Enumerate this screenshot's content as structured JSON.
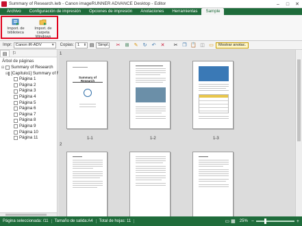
{
  "window": {
    "title": "Summary of Research.iwb - Canon imageRUNNER ADVANCE Desktop - Editor",
    "controls": [
      "–",
      "□",
      "✕"
    ]
  },
  "ribbon_tabs": [
    {
      "label": "Archivo",
      "active": false
    },
    {
      "label": "Configuración de impresión",
      "active": false
    },
    {
      "label": "Opciones de impresión",
      "active": false
    },
    {
      "label": "Anotaciones",
      "active": false
    },
    {
      "label": "Herramientas",
      "active": false
    },
    {
      "label": "Sample",
      "active": true
    }
  ],
  "ribbon": {
    "import_library": "Import. de biblioteca",
    "import_folder": "Import. de carpeta Windows"
  },
  "toolbar": {
    "printer_label": "Impr:",
    "printer_value": "Canon iR-ADV",
    "copies_label": "Copias:",
    "copies_value": "1",
    "duplex_value": "Simpl.",
    "show_annotations": "Mostrar anotac."
  },
  "left_panel": {
    "title": "Árbol de páginas",
    "tree": [
      {
        "label": "Summary of Research",
        "level": 0
      },
      {
        "label": "[Capítulo1] Summary of R",
        "level": 1
      },
      {
        "label": "Página 1",
        "level": 2
      },
      {
        "label": "Página 2",
        "level": 2
      },
      {
        "label": "Página 3",
        "level": 2
      },
      {
        "label": "Página 4",
        "level": 2
      },
      {
        "label": "Página 5",
        "level": 2
      },
      {
        "label": "Página 6",
        "level": 2
      },
      {
        "label": "Página 7",
        "level": 2
      },
      {
        "label": "Página 8",
        "level": 2
      },
      {
        "label": "Página 9",
        "level": 2
      },
      {
        "label": "Página 10",
        "level": 2
      },
      {
        "label": "Página 11",
        "level": 2
      }
    ]
  },
  "thumbnails": {
    "group_labels": [
      "1",
      "2"
    ],
    "row1_captions": [
      "1-1",
      "1-2",
      "1-3"
    ],
    "page1_subtitle": "Summary of Research"
  },
  "status": {
    "selected": "Página seleccionada: /11",
    "output_size": "Tamaño de salida:A4",
    "total": "Total de hojas: 11",
    "zoom": "25%"
  },
  "colors": {
    "brand_green": "#1f6c3b",
    "highlight_red": "#e0001b"
  }
}
